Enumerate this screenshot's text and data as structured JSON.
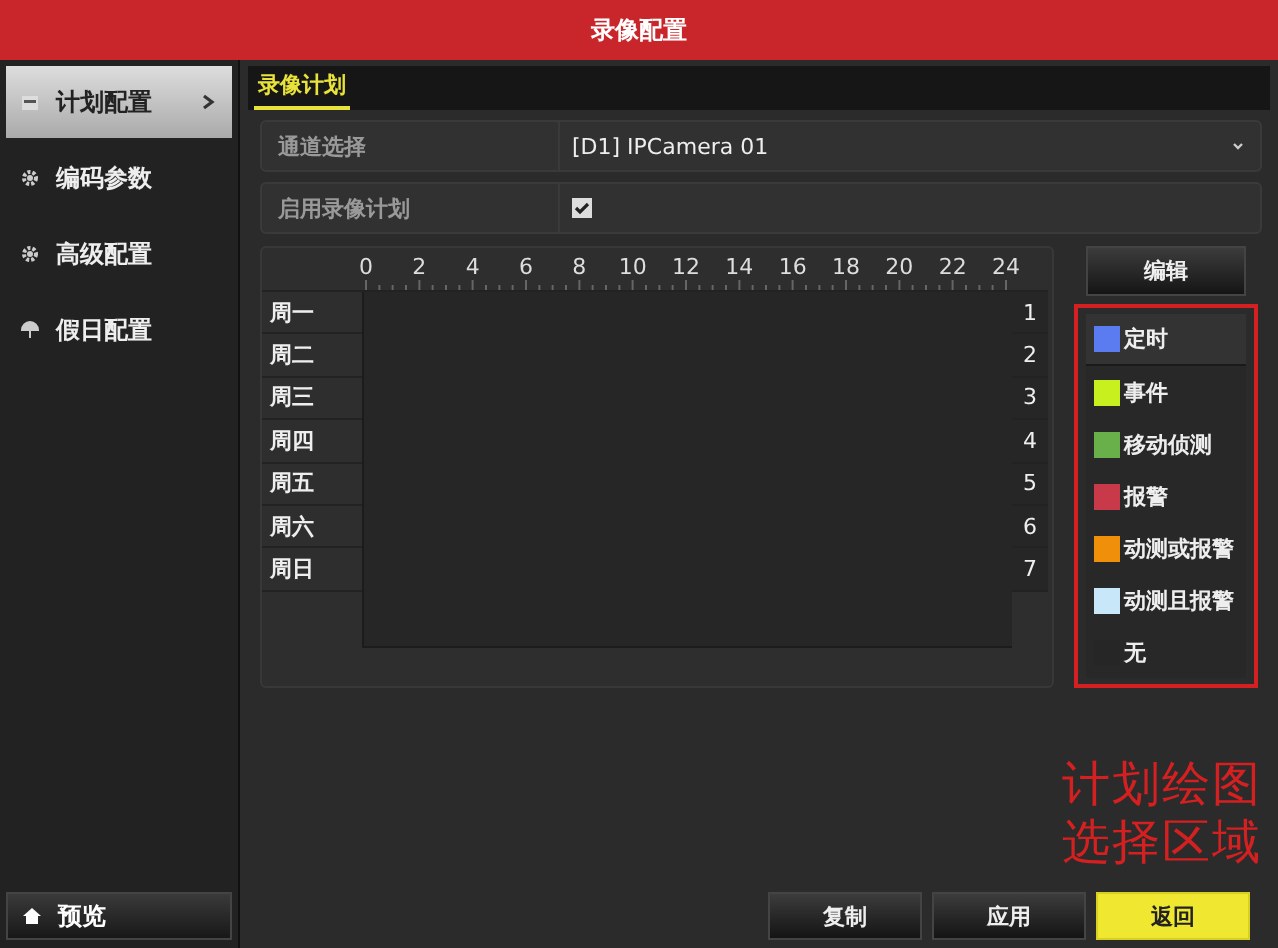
{
  "window": {
    "title": "录像配置"
  },
  "sidebar": {
    "items": [
      {
        "label": "计划配置",
        "selected": true,
        "kind": "schedule"
      },
      {
        "label": "编码参数",
        "selected": false,
        "kind": "encoding"
      },
      {
        "label": "高级配置",
        "selected": false,
        "kind": "advanced"
      },
      {
        "label": "假日配置",
        "selected": false,
        "kind": "holiday"
      }
    ],
    "preview_button": "预览"
  },
  "tabs": [
    {
      "label": "录像计划",
      "selected": true
    }
  ],
  "settings": [
    {
      "kind": "select",
      "label": "通道选择",
      "value": "[D1] IPCamera 01"
    },
    {
      "kind": "checkbox",
      "label": "启用录像计划",
      "checked": true
    }
  ],
  "schedule": {
    "hours": [
      "0",
      "2",
      "4",
      "6",
      "8",
      "10",
      "12",
      "14",
      "16",
      "18",
      "20",
      "22",
      "24"
    ],
    "days": [
      "周一",
      "周二",
      "周三",
      "周四",
      "周五",
      "周六",
      "周日"
    ],
    "row_numbers": [
      "1",
      "2",
      "3",
      "4",
      "5",
      "6",
      "7"
    ]
  },
  "edit_button": "编辑",
  "legend": [
    {
      "label": "定时",
      "color": "#5b7cf0",
      "selected": true
    },
    {
      "label": "事件",
      "color": "#c8f01e",
      "selected": false
    },
    {
      "label": "移动侦测",
      "color": "#6ab04a",
      "selected": false
    },
    {
      "label": "报警",
      "color": "#c83a4a",
      "selected": false
    },
    {
      "label": "动测或报警",
      "color": "#f0900a",
      "selected": false
    },
    {
      "label": "动测且报警",
      "color": "#c8e8fa",
      "selected": false
    },
    {
      "label": "无",
      "selected": false
    }
  ],
  "annotation": [
    "计划绘图",
    "选择区域"
  ],
  "buttons": [
    {
      "label": "复制",
      "kind": "normal"
    },
    {
      "label": "应用",
      "kind": "normal"
    },
    {
      "label": "返回",
      "kind": "primary"
    }
  ]
}
